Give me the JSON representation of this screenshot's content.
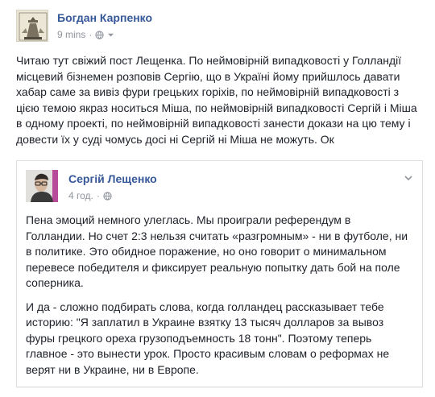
{
  "post": {
    "author": "Богдан Карпенко",
    "time": "9 mins",
    "separator": "·",
    "privacy_icon": "globe-icon",
    "menu_icon": "chevron-down-icon",
    "text": "Читаю тут свіжий пост Лещенка. По неймовірній випадковості у Голландії місцевий бізнемен розповів Сергію, що в Україні йому прийшлось давати хабар саме за вивіз фури грецьких горіхів, по неймовірній випадковості з цією темою якраз носиться Міша, по неймовірній випадковості Сергій і Міша в одному проекті, по неймовірній випадковості занести докази на цю тему і довести їх у суді чомусь досі ні Сергій ні Міша не можуть. Ок"
  },
  "shared_post": {
    "author": "Сергій Лещенко",
    "time": "4 год.",
    "separator": "·",
    "privacy_icon": "globe-icon",
    "menu_icon": "chevron-down-icon",
    "paragraph_1": "Пена эмоций немного улеглась. Мы проиграли референдум в Голландии. Но счет 2:3 нельзя считать «разгромным» - ни в футболе, ни в политике. Это обидное поражение, но оно говорит о минимальном перевесе победителя и фиксирует реальную попытку дать бой на поле соперника.",
    "paragraph_2": "И да - сложно подбирать слова, когда голландец рассказывает тебе историю: \"Я заплатил в Украине взятку 13 тысяч долларов за вывоз фуры грецкого ореха грузоподъемность 18 тонн\". Поэтому теперь главное - это вынести урок. Просто красивым словам о реформах не верят ни в Украине, ни в Европе."
  },
  "colors": {
    "link": "#365899",
    "meta": "#90949c",
    "text": "#1d2129",
    "border": "#dddfe2"
  }
}
